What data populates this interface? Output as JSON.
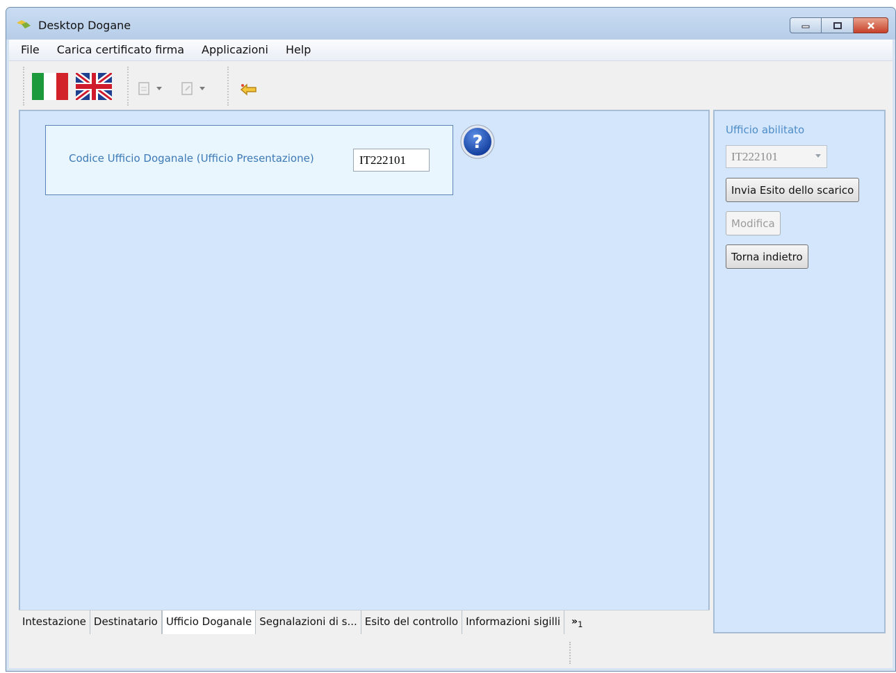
{
  "window": {
    "title": "Desktop Dogane"
  },
  "menu": {
    "items": [
      "File",
      "Carica certificato firma",
      "Applicazioni",
      "Help"
    ]
  },
  "toolbar": {
    "icons": [
      "italy-flag-icon",
      "uk-flag-icon",
      "import-icon",
      "export-icon",
      "back-arrow-icon"
    ]
  },
  "main": {
    "field_label": "Codice Ufficio Doganale (Ufficio Presentazione)",
    "field_value": "IT222101",
    "help_icon": "question-mark-icon"
  },
  "tabs": [
    {
      "label": "Intestazione",
      "active": false
    },
    {
      "label": "Destinatario",
      "active": false
    },
    {
      "label": "Ufficio Doganale",
      "active": true
    },
    {
      "label": "Segnalazioni di s...",
      "active": false
    },
    {
      "label": "Esito del controllo",
      "active": false
    },
    {
      "label": "Informazioni sigilli",
      "active": false
    }
  ],
  "tab_overflow": {
    "symbol": "»",
    "count": "1"
  },
  "side": {
    "title": "Ufficio abilitato",
    "office_value": "IT222101",
    "send_button": "Invia Esito dello scarico",
    "modify_button": "Modifica",
    "back_button": "Torna indietro"
  },
  "colors": {
    "panel_bg": "#d3e6fb",
    "label_blue": "#3b79b7",
    "title_blue": "#4e8cc8"
  }
}
